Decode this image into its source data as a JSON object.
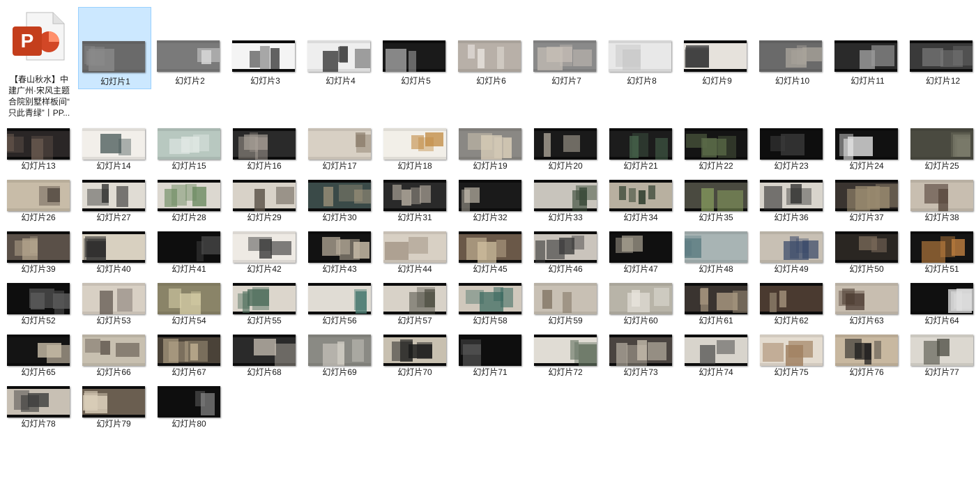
{
  "file": {
    "icon": "powerpoint-file-icon",
    "name_lines": [
      "【春山秋水】中",
      "建广州·宋风主题",
      "合院别墅样板间“",
      "只此青绿”丨PP..."
    ],
    "icon_colors": {
      "orange": "#d24726",
      "light": "#ff8f6b",
      "page": "#f5f5f5"
    }
  },
  "selection": {
    "background": "#cce8ff",
    "border": "#99d1ff"
  },
  "slides": [
    {
      "label": "幻灯片1",
      "tone": "#6a6a6a",
      "accent": "#8a8a8a",
      "bands": "gray",
      "selected": true
    },
    {
      "label": "幻灯片2",
      "tone": "#7a7a7a",
      "accent": "#d8d8d8",
      "bands": "gray"
    },
    {
      "label": "幻灯片3",
      "tone": "#f4f4f4",
      "accent": "#222222",
      "bands": "light-dark"
    },
    {
      "label": "幻灯片4",
      "tone": "#eeeeee",
      "accent": "#2a2a2a",
      "bands": "light"
    },
    {
      "label": "幻灯片5",
      "tone": "#1a1a1a",
      "accent": "#cccccc",
      "bands": "dark"
    },
    {
      "label": "幻灯片6",
      "tone": "#b8b0a8",
      "accent": "#e8e4de",
      "bands": "beige"
    },
    {
      "label": "幻灯片7",
      "tone": "#8a8a8a",
      "accent": "#c8c0b8",
      "bands": "gray"
    },
    {
      "label": "幻灯片8",
      "tone": "#e8e8e8",
      "accent": "#c8c8c8",
      "bands": "light"
    },
    {
      "label": "幻灯片9",
      "tone": "#e6e2dc",
      "accent": "#3a3a3a",
      "bands": "light-dark"
    },
    {
      "label": "幻灯片10",
      "tone": "#6a6a6a",
      "accent": "#a8a29a",
      "bands": "gray"
    },
    {
      "label": "幻灯片11",
      "tone": "#2a2a2a",
      "accent": "#9a9a9a",
      "bands": "dark"
    },
    {
      "label": "幻灯片12",
      "tone": "#3a3a3a",
      "accent": "#7a7a7a",
      "bands": "dark"
    },
    {
      "label": "幻灯片13",
      "tone": "#2a2626",
      "accent": "#6a5a50",
      "bands": "dark"
    },
    {
      "label": "幻灯片14",
      "tone": "#f2efea",
      "accent": "#4a5a5a",
      "bands": "light"
    },
    {
      "label": "幻灯片15",
      "tone": "#b8c8c0",
      "accent": "#e0e8e4",
      "bands": "green"
    },
    {
      "label": "幻灯片16",
      "tone": "#2a2a2a",
      "accent": "#a8a098",
      "bands": "dark"
    },
    {
      "label": "幻灯片17",
      "tone": "#d8d0c4",
      "accent": "#7a6a58",
      "bands": "beige"
    },
    {
      "label": "幻灯片18",
      "tone": "#f2efe8",
      "accent": "#c08a40",
      "bands": "light"
    },
    {
      "label": "幻灯片19",
      "tone": "#8a8884",
      "accent": "#d8ccb8",
      "bands": "gray"
    },
    {
      "label": "幻灯片20",
      "tone": "#1a1a1a",
      "accent": "#c8c0b0",
      "bands": "dark"
    },
    {
      "label": "幻灯片21",
      "tone": "#1c1c1c",
      "accent": "#4a6a50",
      "bands": "dark"
    },
    {
      "label": "幻灯片22",
      "tone": "#141414",
      "accent": "#5a6a48",
      "bands": "dark"
    },
    {
      "label": "幻灯片23",
      "tone": "#0e0e0e",
      "accent": "#3a3a3a",
      "bands": "dark"
    },
    {
      "label": "幻灯片24",
      "tone": "#111111",
      "accent": "#e0e0e0",
      "bands": "dark"
    },
    {
      "label": "幻灯片25",
      "tone": "#4a4a40",
      "accent": "#7a7a6a",
      "bands": "gray"
    },
    {
      "label": "幻灯片26",
      "tone": "#c8bca8",
      "accent": "#4a4038",
      "bands": "beige"
    },
    {
      "label": "幻灯片27",
      "tone": "#e0dcd4",
      "accent": "#2a2a2a",
      "bands": "light-dark"
    },
    {
      "label": "幻灯片28",
      "tone": "#dcd8d0",
      "accent": "#6a8a60",
      "bands": "light-dark"
    },
    {
      "label": "幻灯片29",
      "tone": "#d8d2c8",
      "accent": "#5a5248",
      "bands": "light-dark"
    },
    {
      "label": "幻灯片30",
      "tone": "#3a4a48",
      "accent": "#a89a80",
      "bands": "dark"
    },
    {
      "label": "幻灯片31",
      "tone": "#2a2a2a",
      "accent": "#c8beb0",
      "bands": "dark"
    },
    {
      "label": "幻灯片32",
      "tone": "#1a1a1a",
      "accent": "#d8d0c0",
      "bands": "dark"
    },
    {
      "label": "幻灯片33",
      "tone": "#c8c4bc",
      "accent": "#3a4a38",
      "bands": "light-dark"
    },
    {
      "label": "幻灯片34",
      "tone": "#b8b0a0",
      "accent": "#2a3a2a",
      "bands": "light-dark"
    },
    {
      "label": "幻灯片35",
      "tone": "#4a4a40",
      "accent": "#8aa060",
      "bands": "dark"
    },
    {
      "label": "幻灯片36",
      "tone": "#d8d4cc",
      "accent": "#2a2a2a",
      "bands": "light-dark"
    },
    {
      "label": "幻灯片37",
      "tone": "#3a3430",
      "accent": "#9a8a70",
      "bands": "dark"
    },
    {
      "label": "幻灯片38",
      "tone": "#c8beb0",
      "accent": "#5a4a40",
      "bands": "beige"
    },
    {
      "label": "幻灯片39",
      "tone": "#5a5048",
      "accent": "#b8a890",
      "bands": "dark"
    },
    {
      "label": "幻灯片40",
      "tone": "#d8d0c0",
      "accent": "#2a2a2a",
      "bands": "light-dark"
    },
    {
      "label": "幻灯片41",
      "tone": "#0e0e0e",
      "accent": "#4a4a4a",
      "bands": "dark"
    },
    {
      "label": "幻灯片42",
      "tone": "#eeeae4",
      "accent": "#3a3a3a",
      "bands": "light"
    },
    {
      "label": "幻灯片43",
      "tone": "#121212",
      "accent": "#c8bca8",
      "bands": "dark"
    },
    {
      "label": "幻灯片44",
      "tone": "#d8d0c4",
      "accent": "#8a7a68",
      "bands": "beige"
    },
    {
      "label": "幻灯片45",
      "tone": "#6a5848",
      "accent": "#d0c0a0",
      "bands": "dark"
    },
    {
      "label": "幻灯片46",
      "tone": "#cac4bc",
      "accent": "#3a3a3a",
      "bands": "light-dark"
    },
    {
      "label": "幻灯片47",
      "tone": "#101010",
      "accent": "#b8b0a0",
      "bands": "dark"
    },
    {
      "label": "幻灯片48",
      "tone": "#a8b4b4",
      "accent": "#5a7a80",
      "bands": "green"
    },
    {
      "label": "幻灯片49",
      "tone": "#c8c0b4",
      "accent": "#3a4a6a",
      "bands": "beige"
    },
    {
      "label": "幻灯片50",
      "tone": "#2a2622",
      "accent": "#7a6a5a",
      "bands": "dark"
    },
    {
      "label": "幻灯片51",
      "tone": "#141414",
      "accent": "#c08040",
      "bands": "dark"
    },
    {
      "label": "幻灯片52",
      "tone": "#0e0e0e",
      "accent": "#5a5a5a",
      "bands": "dark"
    },
    {
      "label": "幻灯片53",
      "tone": "#d8d0c4",
      "accent": "#5a5048",
      "bands": "beige"
    },
    {
      "label": "幻灯片54",
      "tone": "#8a8468",
      "accent": "#d8d0a8",
      "bands": "gray"
    },
    {
      "label": "幻灯片55",
      "tone": "#dcd6cc",
      "accent": "#4a6a58",
      "bands": "light-dark"
    },
    {
      "label": "幻灯片56",
      "tone": "#e0dcd4",
      "accent": "#4a7a70",
      "bands": "light-dark"
    },
    {
      "label": "幻灯片57",
      "tone": "#d8d2c8",
      "accent": "#4a4a40",
      "bands": "light-dark"
    },
    {
      "label": "幻灯片58",
      "tone": "#d0c8bc",
      "accent": "#3a6a60",
      "bands": "light-dark"
    },
    {
      "label": "幻灯片59",
      "tone": "#c8c0b4",
      "accent": "#6a5a48",
      "bands": "beige"
    },
    {
      "label": "幻灯片60",
      "tone": "#b8b4a8",
      "accent": "#e8e4dc",
      "bands": "beige"
    },
    {
      "label": "幻灯片61",
      "tone": "#3a3430",
      "accent": "#a89880",
      "bands": "dark"
    },
    {
      "label": "幻灯片62",
      "tone": "#4a3a30",
      "accent": "#b0a088",
      "bands": "dark"
    },
    {
      "label": "幻灯片63",
      "tone": "#c8beb0",
      "accent": "#4a3a30",
      "bands": "beige"
    },
    {
      "label": "幻灯片64",
      "tone": "#101010",
      "accent": "#e0e0e0",
      "bands": "dark"
    },
    {
      "label": "幻灯片65",
      "tone": "#141414",
      "accent": "#c8bca8",
      "bands": "dark"
    },
    {
      "label": "幻灯片66",
      "tone": "#c8c0b0",
      "accent": "#4a4038",
      "bands": "beige"
    },
    {
      "label": "幻灯片67",
      "tone": "#4a4238",
      "accent": "#c8b898",
      "bands": "dark"
    },
    {
      "label": "幻灯片68",
      "tone": "#2a2a2a",
      "accent": "#c8c0b4",
      "bands": "dark"
    },
    {
      "label": "幻灯片69",
      "tone": "#8a8a84",
      "accent": "#d0ccc4",
      "bands": "gray"
    },
    {
      "label": "幻灯片70",
      "tone": "#c8c0b0",
      "accent": "#1a1a1a",
      "bands": "light-dark"
    },
    {
      "label": "幻灯片71",
      "tone": "#0e0e0e",
      "accent": "#6a6a6a",
      "bands": "dark"
    },
    {
      "label": "幻灯片72",
      "tone": "#e0dcd4",
      "accent": "#5a6a58",
      "bands": "light-dark"
    },
    {
      "label": "幻灯片73",
      "tone": "#4a4440",
      "accent": "#c8c0b0",
      "bands": "dark"
    },
    {
      "label": "幻灯片74",
      "tone": "#d8d4cc",
      "accent": "#3a3a3a",
      "bands": "light-dark"
    },
    {
      "label": "幻灯片75",
      "tone": "#e4dcd0",
      "accent": "#a08060",
      "bands": "beige"
    },
    {
      "label": "幻灯片76",
      "tone": "#c8b8a0",
      "accent": "#1a1a1a",
      "bands": "beige"
    },
    {
      "label": "幻灯片77",
      "tone": "#dcd8d0",
      "accent": "#4a4a40",
      "bands": "light"
    },
    {
      "label": "幻灯片78",
      "tone": "#c8c0b4",
      "accent": "#3a3a3a",
      "bands": "light-dark"
    },
    {
      "label": "幻灯片79",
      "tone": "#6a5e50",
      "accent": "#d8ccb8",
      "bands": "dark"
    },
    {
      "label": "幻灯片80",
      "tone": "#0e0e0e",
      "accent": "#8a8a8a",
      "bands": "dark"
    }
  ]
}
